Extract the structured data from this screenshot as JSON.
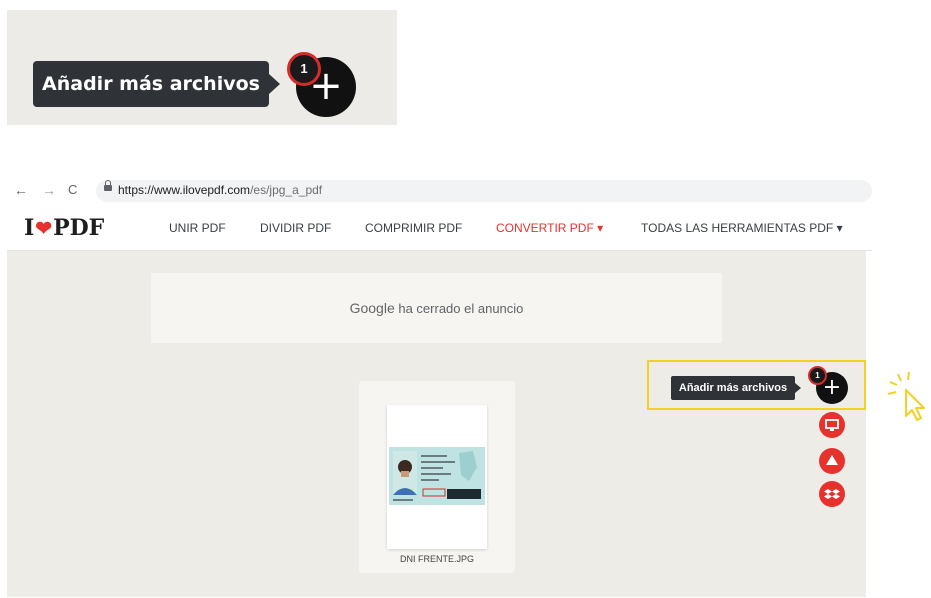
{
  "callout": {
    "tooltip": "Añadir más archivos",
    "plus": "+",
    "badge": "1"
  },
  "browser": {
    "back": "←",
    "forward": "→",
    "reload": "C",
    "url_host": "https://www.ilovepdf.com",
    "url_path": "/es/jpg_a_pdf"
  },
  "site": {
    "logo_left": "I",
    "logo_heart": "❤",
    "logo_right": "PDF",
    "nav": [
      {
        "label": "UNIR PDF"
      },
      {
        "label": "DIVIDIR PDF"
      },
      {
        "label": "COMPRIMIR PDF"
      },
      {
        "label": "CONVERTIR PDF ▾"
      },
      {
        "label": "TODAS LAS HERRAMIENTAS PDF ▾"
      }
    ],
    "accent_color": "#e5322d"
  },
  "ad": {
    "google": "Google",
    "text": " ha cerrado el anuncio"
  },
  "file": {
    "name": "DNI FRENTE.JPG"
  },
  "actions": {
    "tooltip": "Añadir más archivos",
    "plus": "+",
    "badge": "1",
    "buttons": [
      {
        "icon": "computer-icon"
      },
      {
        "icon": "google-drive-icon"
      },
      {
        "icon": "dropbox-icon"
      }
    ]
  },
  "highlight_color": "#f3d024"
}
